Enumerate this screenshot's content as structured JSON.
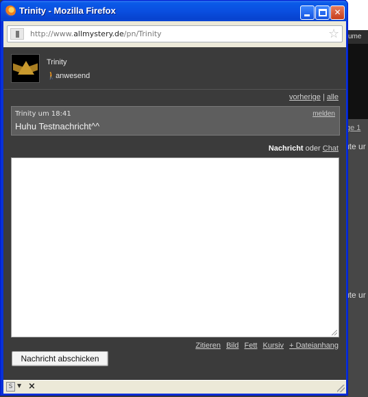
{
  "window": {
    "title": "Trinity - Mozilla Firefox"
  },
  "urlbar": {
    "prefix": "http://www.",
    "domain": "allmystery.de",
    "path": "/pn/Trinity"
  },
  "profile": {
    "name": "Trinity",
    "status": "anwesend"
  },
  "nav": {
    "prev": "vorherige",
    "separator": "|",
    "all": "alle"
  },
  "message": {
    "meta": "Trinity um 18:41",
    "report": "melden",
    "text": "Huhu Testnachricht^^"
  },
  "mode": {
    "active": "Nachricht",
    "or": "oder",
    "alt": "Chat"
  },
  "editor": {
    "value": ""
  },
  "toolbar": {
    "quote": "Zitieren",
    "image": "Bild",
    "bold": "Fett",
    "italic": "Kursiv",
    "attach": "+ Dateianhang"
  },
  "send": {
    "label": "Nachricht abschicken"
  },
  "background": {
    "nav_fragment": "ume",
    "link_fragment": "ge  1",
    "text_fragment1": "ute ur",
    "text_fragment2": "ute ur"
  },
  "colors": {
    "titlebar": "#0a4fe0",
    "content_bg": "#3b3b3b",
    "message_bg": "#5e5e5e",
    "chrome_bg": "#ece9d8"
  }
}
